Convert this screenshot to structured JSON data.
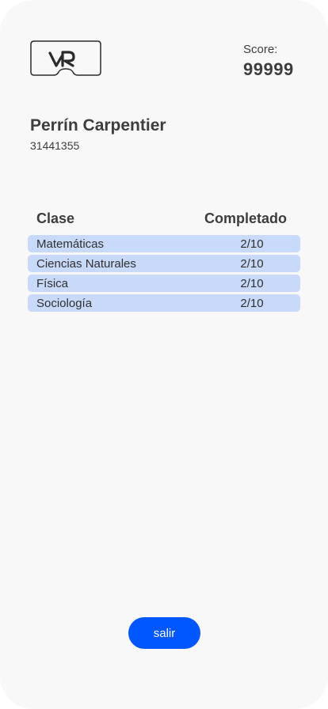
{
  "header": {
    "logo_icon": "vr-headset-logo-icon",
    "score_label": "Score:",
    "score_value": "99999"
  },
  "user": {
    "name": "Perrín Carpentier",
    "id": "31441355"
  },
  "table": {
    "columns": [
      "Clase",
      "Completado"
    ],
    "rows": [
      {
        "clase": "Matemáticas",
        "completado": "2/10"
      },
      {
        "clase": "Ciencias Naturales",
        "completado": "2/10"
      },
      {
        "clase": "Física",
        "completado": "2/10"
      },
      {
        "clase": "Sociología",
        "completado": "2/10"
      }
    ],
    "row_color": "#c9d9fa"
  },
  "actions": {
    "exit_label": "salir",
    "exit_color": "#0057ff"
  }
}
